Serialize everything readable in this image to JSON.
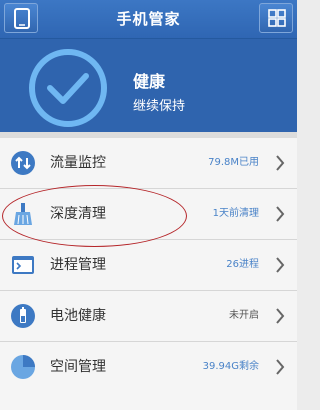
{
  "header": {
    "title": "手机管家"
  },
  "status": {
    "title": "健康",
    "subtitle": "继续保持"
  },
  "menu": [
    {
      "label": "流量监控",
      "status": "79.8M已用",
      "icon": "traffic-icon"
    },
    {
      "label": "深度清理",
      "status": "1天前清理",
      "icon": "broom-icon"
    },
    {
      "label": "进程管理",
      "status": "26进程",
      "icon": "process-icon"
    },
    {
      "label": "电池健康",
      "status": "未开启",
      "icon": "battery-icon"
    },
    {
      "label": "空间管理",
      "status": "39.94G剩余",
      "icon": "storage-icon"
    }
  ],
  "colors": {
    "header_blue": "#2f66b3",
    "hero_blue": "#2f64ae",
    "status_blue": "#4a83c8",
    "annotation_red": "#b5262a"
  }
}
